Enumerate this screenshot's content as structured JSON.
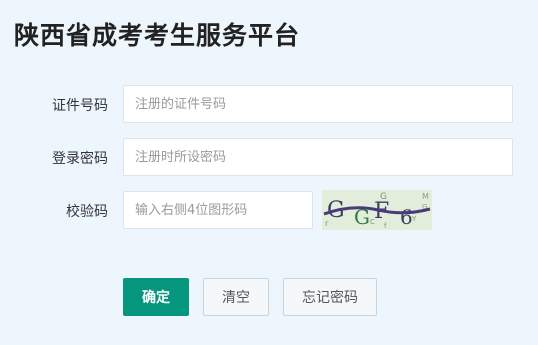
{
  "header": {
    "title": "陕西省成考考生服务平台"
  },
  "form": {
    "id_number": {
      "label": "证件号码",
      "value": "",
      "placeholder": "注册的证件号码"
    },
    "password": {
      "label": "登录密码",
      "value": "",
      "placeholder": "注册时所设密码"
    },
    "captcha": {
      "label": "校验码",
      "value": "",
      "placeholder": "输入右侧4位图形码",
      "image_text": "GGF6",
      "image_bg_color": "#e2eddb"
    }
  },
  "actions": {
    "submit_label": "确定",
    "clear_label": "清空",
    "forgot_label": "忘记密码"
  },
  "colors": {
    "page_bg": "#eef6fd",
    "primary": "#05967d",
    "default_button_bg": "#f4f8fb"
  }
}
